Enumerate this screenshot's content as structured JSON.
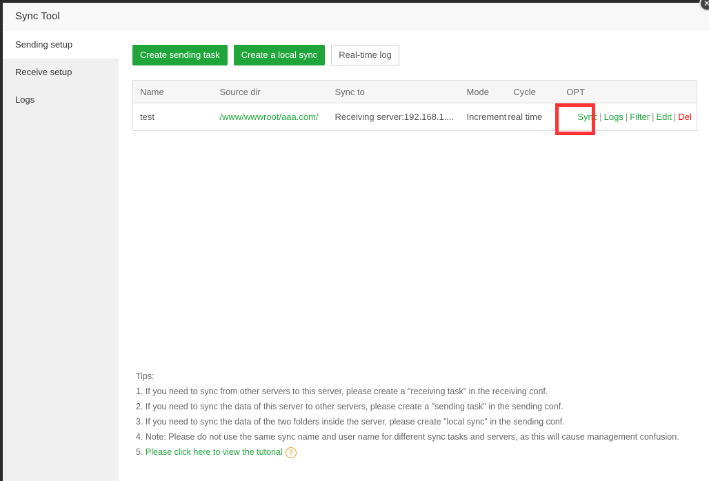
{
  "window": {
    "title": "Sync Tool",
    "close_icon": "close-icon"
  },
  "sidebar": {
    "items": [
      {
        "label": "Sending setup",
        "active": true
      },
      {
        "label": "Receive setup"
      },
      {
        "label": "Logs"
      }
    ]
  },
  "toolbar": {
    "create_sending": "Create sending task",
    "create_local": "Create a local sync",
    "realtime_log": "Real-time log"
  },
  "table": {
    "headers": [
      "Name",
      "Source dir",
      "Sync to",
      "Mode",
      "Cycle",
      "OPT"
    ],
    "rows": [
      {
        "name": "test",
        "source": "/www/wwwroot/aaa.com/",
        "sync_to": "Receiving server:192.168.1....",
        "mode": "Increment",
        "cycle": "real time",
        "ops": {
          "sync": "Sync",
          "logs": "Logs",
          "filter": "Filter",
          "edit": "Edit",
          "del": "Del",
          "sep": "|"
        }
      }
    ]
  },
  "tips": {
    "title": "Tips:",
    "lines": [
      "1. If you need to sync from other servers to this server, please create a \"receiving task\" in the receiving conf.",
      "2. If you need to sync the data of this server to other servers, please create a \"sending task\" in the sending conf.",
      "3. If you need to sync the data of the two folders inside the server, please create \"local sync\" in the sending conf.",
      "4. Note: Please do not use the same sync name and user name for different sync tasks and servers, as this will cause management confusion."
    ],
    "prefix5": "5. ",
    "tutorial_link": "Please click here to view the tutorial",
    "help_glyph": "?"
  },
  "colors": {
    "accent": "#20a53a",
    "danger": "#ff0000",
    "highlight": "#ff3333"
  }
}
